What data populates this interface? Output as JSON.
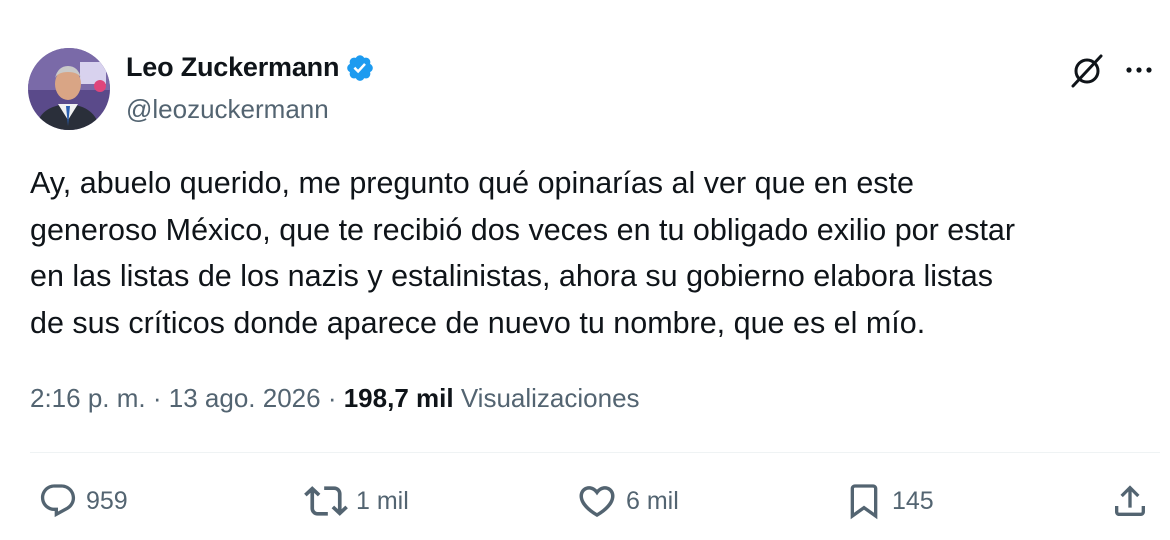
{
  "author": {
    "display_name": "Leo Zuckermann",
    "handle": "@leozuckermann",
    "verified": true
  },
  "tweet": {
    "text": "Ay, abuelo querido, me pregunto qué opinarías al ver que en este\ngeneroso México, que te recibió dos veces en tu obligado exilio por estar\nen las listas de los nazis y estalinistas, ahora su gobierno elabora listas\nde sus críticos donde aparece de nuevo tu nombre, que es el mío.",
    "time": "2:16 p. m.",
    "separator": "·",
    "date": "13 ago. 2026",
    "views_count": "198,7 mil",
    "views_label": "Visualizaciones"
  },
  "actions": {
    "reply_count": "959",
    "retweet_count": "1 mil",
    "like_count": "6 mil",
    "bookmark_count": "145"
  },
  "icons": {
    "verified": "verified-badge-icon",
    "grok": "grok-icon",
    "more": "more-dots-icon",
    "reply": "reply-icon",
    "retweet": "retweet-icon",
    "like": "heart-icon",
    "bookmark": "bookmark-icon",
    "share": "share-icon"
  },
  "colors": {
    "text": "#0f1419",
    "secondary": "#536471",
    "verified": "#1d9bf0",
    "divider": "#eff3f4"
  }
}
